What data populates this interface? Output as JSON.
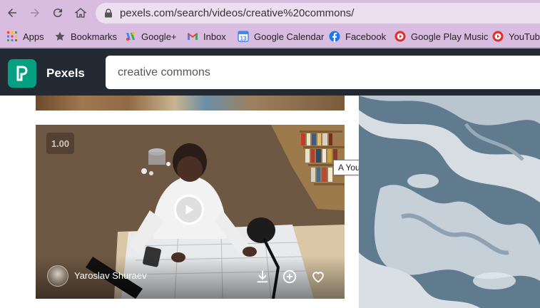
{
  "browser": {
    "url": "pexels.com/search/videos/creative%20commons/"
  },
  "bookmarks": [
    {
      "label": "Apps",
      "icon": "apps-grid-icon"
    },
    {
      "label": "Bookmarks",
      "icon": "star-icon"
    },
    {
      "label": "Google+",
      "icon": "google-plus-icon"
    },
    {
      "label": "Inbox",
      "icon": "gmail-icon"
    },
    {
      "label": "Google Calendar",
      "icon": "calendar-icon"
    },
    {
      "label": "Facebook",
      "icon": "facebook-icon"
    },
    {
      "label": "Google Play Music",
      "icon": "play-music-icon"
    },
    {
      "label": "YouTube",
      "icon": "youtube-icon"
    }
  ],
  "header": {
    "brand": "Pexels",
    "search_value": "creative commons"
  },
  "video": {
    "speed": "1.00",
    "author": "Yaroslav Shuraev",
    "tooltip": "A Young Architect Working over Design"
  },
  "colors": {
    "header_bg": "#232a34",
    "brand_green": "#05a081",
    "chrome_bg": "#d9bde0"
  }
}
